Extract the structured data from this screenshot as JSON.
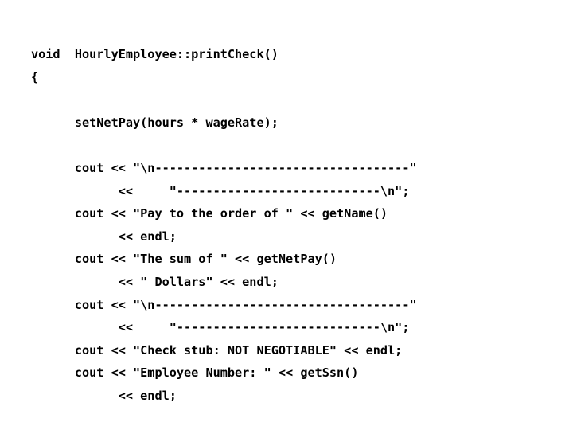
{
  "slide": {
    "background_color": "#ffffff",
    "text_color": "#000000",
    "language": "cpp",
    "title": "HourlyEmployee::printCheck()"
  },
  "code": {
    "lines": [
      "void  HourlyEmployee::printCheck()",
      "{",
      "",
      "      setNetPay(hours * wageRate);",
      "",
      "      cout << \"\\n-----------------------------------\"",
      "            <<     \"----------------------------\\n\";",
      "      cout << \"Pay to the order of \" << getName()",
      "            << endl;",
      "      cout << \"The sum of \" << getNetPay()",
      "            << \" Dollars\" << endl;",
      "      cout << \"\\n-----------------------------------\"",
      "            <<     \"----------------------------\\n\";",
      "      cout << \"Check stub: NOT NEGOTIABLE\" << endl;",
      "      cout << \"Employee Number: \" << getSsn()",
      "            << endl;"
    ]
  }
}
